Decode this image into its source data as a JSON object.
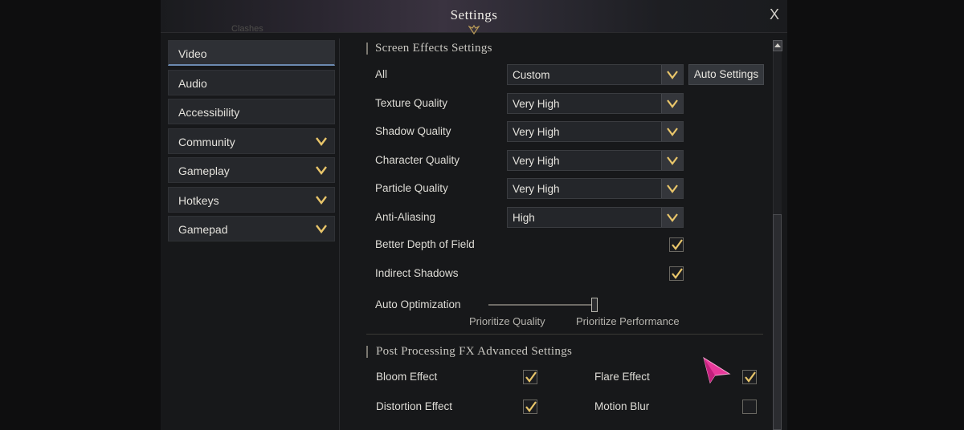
{
  "window": {
    "title": "Settings",
    "close_label": "X",
    "ghost_tab": "Clashes"
  },
  "sidebar": {
    "items": [
      {
        "label": "Video",
        "active": true,
        "has_chevron": false
      },
      {
        "label": "Audio",
        "active": false,
        "has_chevron": false
      },
      {
        "label": "Accessibility",
        "active": false,
        "has_chevron": false
      },
      {
        "label": "Community",
        "active": false,
        "has_chevron": true
      },
      {
        "label": "Gameplay",
        "active": false,
        "has_chevron": true
      },
      {
        "label": "Hotkeys",
        "active": false,
        "has_chevron": true
      },
      {
        "label": "Gamepad",
        "active": false,
        "has_chevron": true
      }
    ]
  },
  "screen_effects": {
    "title": "Screen Effects Settings",
    "auto_settings_label": "Auto Settings",
    "dropdowns": [
      {
        "label": "All",
        "value": "Custom"
      },
      {
        "label": "Texture Quality",
        "value": "Very High"
      },
      {
        "label": "Shadow Quality",
        "value": "Very High"
      },
      {
        "label": "Character Quality",
        "value": "Very High"
      },
      {
        "label": "Particle Quality",
        "value": "Very High"
      },
      {
        "label": "Anti-Aliasing",
        "value": "High"
      }
    ],
    "checkboxes": [
      {
        "label": "Better Depth of Field",
        "checked": true
      },
      {
        "label": "Indirect Shadows",
        "checked": true
      }
    ],
    "auto_optimization": {
      "label": "Auto Optimization",
      "left_caption": "Prioritize Quality",
      "right_caption": "Prioritize Performance",
      "level": 1.0
    }
  },
  "post_processing": {
    "title": "Post Processing FX Advanced Settings",
    "bloom": {
      "label": "Bloom Effect",
      "checked": true
    },
    "flare": {
      "label": "Flare Effect",
      "checked": true
    },
    "distortion": {
      "label": "Distortion Effect",
      "checked": true
    },
    "motion_blur": {
      "label": "Motion Blur",
      "checked": false
    }
  },
  "colors": {
    "accent_gold": "#e8c56a",
    "active_underline": "#6c8ab0",
    "pointer_pink": "#e8399a"
  }
}
